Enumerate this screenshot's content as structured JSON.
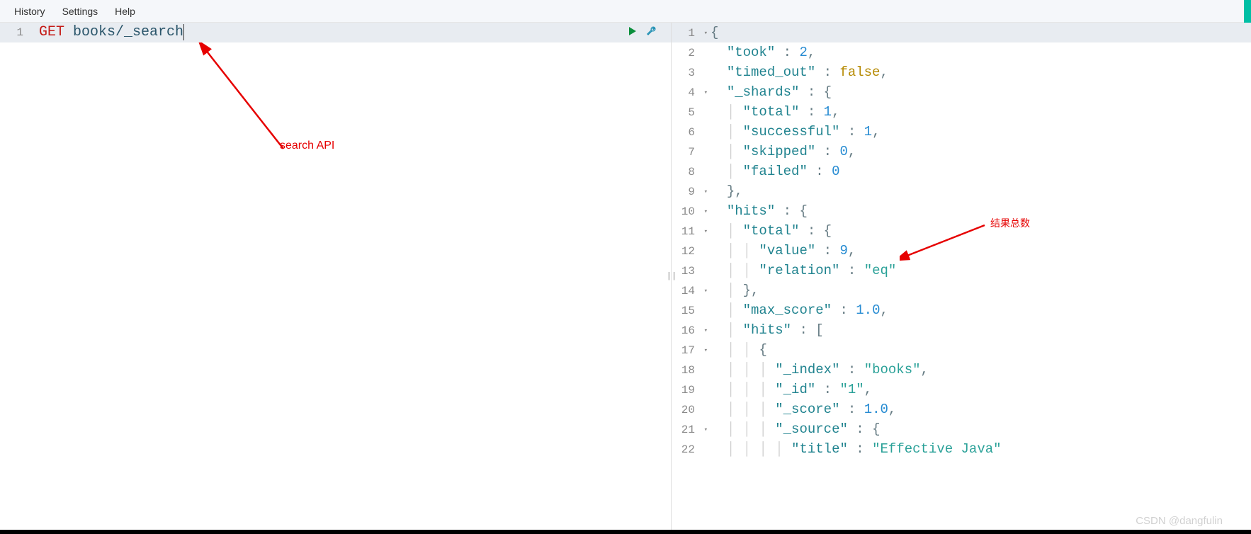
{
  "menubar": {
    "history": "History",
    "settings": "Settings",
    "help": "Help"
  },
  "request": {
    "line_no": "1",
    "method": "GET",
    "path": "books/_search"
  },
  "response_lines": [
    {
      "no": "1",
      "fold": true,
      "tokens": [
        {
          "t": "{",
          "c": "punc"
        }
      ]
    },
    {
      "no": "2",
      "tokens": [
        {
          "t": "  ",
          "c": ""
        },
        {
          "t": "\"took\"",
          "c": "key"
        },
        {
          "t": " : ",
          "c": "punc"
        },
        {
          "t": "2",
          "c": "num"
        },
        {
          "t": ",",
          "c": "punc"
        }
      ]
    },
    {
      "no": "3",
      "tokens": [
        {
          "t": "  ",
          "c": ""
        },
        {
          "t": "\"timed_out\"",
          "c": "key"
        },
        {
          "t": " : ",
          "c": "punc"
        },
        {
          "t": "false",
          "c": "bool"
        },
        {
          "t": ",",
          "c": "punc"
        }
      ]
    },
    {
      "no": "4",
      "fold": true,
      "tokens": [
        {
          "t": "  ",
          "c": ""
        },
        {
          "t": "\"_shards\"",
          "c": "key"
        },
        {
          "t": " : ",
          "c": "punc"
        },
        {
          "t": "{",
          "c": "punc"
        }
      ]
    },
    {
      "no": "5",
      "tokens": [
        {
          "t": "  ",
          "c": ""
        },
        {
          "t": "│ ",
          "c": "guide"
        },
        {
          "t": "\"total\"",
          "c": "key"
        },
        {
          "t": " : ",
          "c": "punc"
        },
        {
          "t": "1",
          "c": "num"
        },
        {
          "t": ",",
          "c": "punc"
        }
      ]
    },
    {
      "no": "6",
      "tokens": [
        {
          "t": "  ",
          "c": ""
        },
        {
          "t": "│ ",
          "c": "guide"
        },
        {
          "t": "\"successful\"",
          "c": "key"
        },
        {
          "t": " : ",
          "c": "punc"
        },
        {
          "t": "1",
          "c": "num"
        },
        {
          "t": ",",
          "c": "punc"
        }
      ]
    },
    {
      "no": "7",
      "tokens": [
        {
          "t": "  ",
          "c": ""
        },
        {
          "t": "│ ",
          "c": "guide"
        },
        {
          "t": "\"skipped\"",
          "c": "key"
        },
        {
          "t": " : ",
          "c": "punc"
        },
        {
          "t": "0",
          "c": "num"
        },
        {
          "t": ",",
          "c": "punc"
        }
      ]
    },
    {
      "no": "8",
      "tokens": [
        {
          "t": "  ",
          "c": ""
        },
        {
          "t": "│ ",
          "c": "guide"
        },
        {
          "t": "\"failed\"",
          "c": "key"
        },
        {
          "t": " : ",
          "c": "punc"
        },
        {
          "t": "0",
          "c": "num"
        }
      ]
    },
    {
      "no": "9",
      "fold": true,
      "tokens": [
        {
          "t": "  ",
          "c": ""
        },
        {
          "t": "},",
          "c": "punc"
        }
      ]
    },
    {
      "no": "10",
      "fold": true,
      "tokens": [
        {
          "t": "  ",
          "c": ""
        },
        {
          "t": "\"hits\"",
          "c": "key"
        },
        {
          "t": " : ",
          "c": "punc"
        },
        {
          "t": "{",
          "c": "punc"
        }
      ]
    },
    {
      "no": "11",
      "fold": true,
      "tokens": [
        {
          "t": "  ",
          "c": ""
        },
        {
          "t": "│ ",
          "c": "guide"
        },
        {
          "t": "\"total\"",
          "c": "key"
        },
        {
          "t": " : ",
          "c": "punc"
        },
        {
          "t": "{",
          "c": "punc"
        }
      ]
    },
    {
      "no": "12",
      "tokens": [
        {
          "t": "  ",
          "c": ""
        },
        {
          "t": "│ ",
          "c": "guide"
        },
        {
          "t": "│ ",
          "c": "guide"
        },
        {
          "t": "\"value\"",
          "c": "key"
        },
        {
          "t": " : ",
          "c": "punc"
        },
        {
          "t": "9",
          "c": "num"
        },
        {
          "t": ",",
          "c": "punc"
        }
      ]
    },
    {
      "no": "13",
      "tokens": [
        {
          "t": "  ",
          "c": ""
        },
        {
          "t": "│ ",
          "c": "guide"
        },
        {
          "t": "│ ",
          "c": "guide"
        },
        {
          "t": "\"relation\"",
          "c": "key"
        },
        {
          "t": " : ",
          "c": "punc"
        },
        {
          "t": "\"eq\"",
          "c": "str"
        }
      ]
    },
    {
      "no": "14",
      "fold": true,
      "tokens": [
        {
          "t": "  ",
          "c": ""
        },
        {
          "t": "│ ",
          "c": "guide"
        },
        {
          "t": "},",
          "c": "punc"
        }
      ]
    },
    {
      "no": "15",
      "tokens": [
        {
          "t": "  ",
          "c": ""
        },
        {
          "t": "│ ",
          "c": "guide"
        },
        {
          "t": "\"max_score\"",
          "c": "key"
        },
        {
          "t": " : ",
          "c": "punc"
        },
        {
          "t": "1.0",
          "c": "num"
        },
        {
          "t": ",",
          "c": "punc"
        }
      ]
    },
    {
      "no": "16",
      "fold": true,
      "tokens": [
        {
          "t": "  ",
          "c": ""
        },
        {
          "t": "│ ",
          "c": "guide"
        },
        {
          "t": "\"hits\"",
          "c": "key"
        },
        {
          "t": " : ",
          "c": "punc"
        },
        {
          "t": "[",
          "c": "punc"
        }
      ]
    },
    {
      "no": "17",
      "fold": true,
      "tokens": [
        {
          "t": "  ",
          "c": ""
        },
        {
          "t": "│ ",
          "c": "guide"
        },
        {
          "t": "│ ",
          "c": "guide"
        },
        {
          "t": "{",
          "c": "punc"
        }
      ]
    },
    {
      "no": "18",
      "tokens": [
        {
          "t": "  ",
          "c": ""
        },
        {
          "t": "│ ",
          "c": "guide"
        },
        {
          "t": "│ ",
          "c": "guide"
        },
        {
          "t": "│ ",
          "c": "guide"
        },
        {
          "t": "\"_index\"",
          "c": "key"
        },
        {
          "t": " : ",
          "c": "punc"
        },
        {
          "t": "\"books\"",
          "c": "str"
        },
        {
          "t": ",",
          "c": "punc"
        }
      ]
    },
    {
      "no": "19",
      "tokens": [
        {
          "t": "  ",
          "c": ""
        },
        {
          "t": "│ ",
          "c": "guide"
        },
        {
          "t": "│ ",
          "c": "guide"
        },
        {
          "t": "│ ",
          "c": "guide"
        },
        {
          "t": "\"_id\"",
          "c": "key"
        },
        {
          "t": " : ",
          "c": "punc"
        },
        {
          "t": "\"1\"",
          "c": "str"
        },
        {
          "t": ",",
          "c": "punc"
        }
      ]
    },
    {
      "no": "20",
      "tokens": [
        {
          "t": "  ",
          "c": ""
        },
        {
          "t": "│ ",
          "c": "guide"
        },
        {
          "t": "│ ",
          "c": "guide"
        },
        {
          "t": "│ ",
          "c": "guide"
        },
        {
          "t": "\"_score\"",
          "c": "key"
        },
        {
          "t": " : ",
          "c": "punc"
        },
        {
          "t": "1.0",
          "c": "num"
        },
        {
          "t": ",",
          "c": "punc"
        }
      ]
    },
    {
      "no": "21",
      "fold": true,
      "tokens": [
        {
          "t": "  ",
          "c": ""
        },
        {
          "t": "│ ",
          "c": "guide"
        },
        {
          "t": "│ ",
          "c": "guide"
        },
        {
          "t": "│ ",
          "c": "guide"
        },
        {
          "t": "\"_source\"",
          "c": "key"
        },
        {
          "t": " : ",
          "c": "punc"
        },
        {
          "t": "{",
          "c": "punc"
        }
      ]
    },
    {
      "no": "22",
      "tokens": [
        {
          "t": "  ",
          "c": ""
        },
        {
          "t": "│ ",
          "c": "guide"
        },
        {
          "t": "│ ",
          "c": "guide"
        },
        {
          "t": "│ ",
          "c": "guide"
        },
        {
          "t": "│ ",
          "c": "guide"
        },
        {
          "t": "\"title\"",
          "c": "key"
        },
        {
          "t": " : ",
          "c": "punc"
        },
        {
          "t": "\"Effective Java\"",
          "c": "str"
        }
      ]
    }
  ],
  "annotations": {
    "search_api": "search API",
    "result_count": "结果总数"
  },
  "watermark": "CSDN @dangfulin"
}
